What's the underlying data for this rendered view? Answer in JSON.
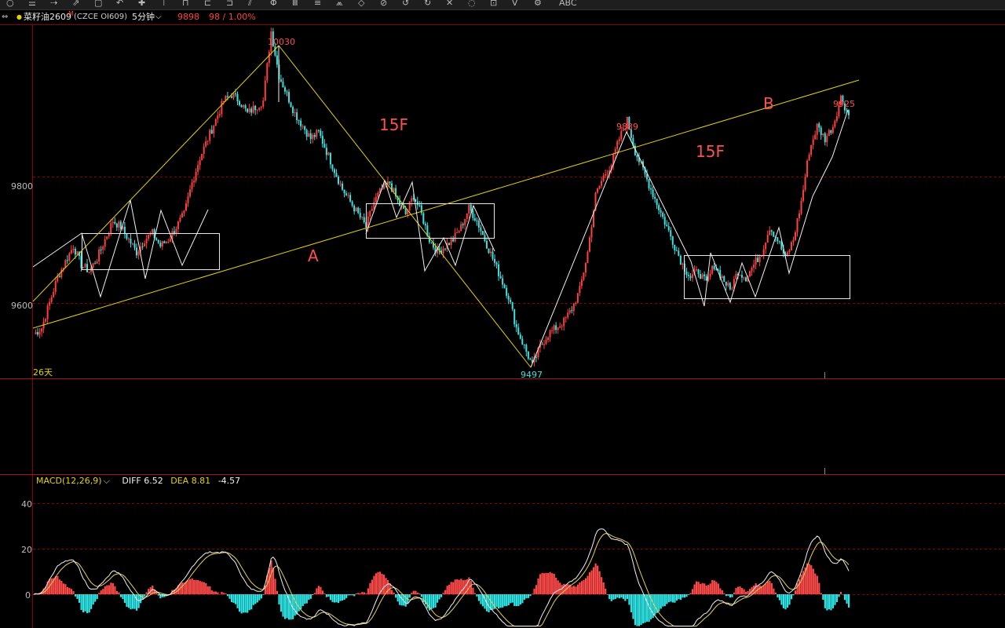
{
  "toolbar": {
    "icons": [
      "circle-icon",
      "list-icon",
      "arrow-icon",
      "pointer-icon",
      "draw-icon",
      "select-icon",
      "crosshair-icon",
      "measure-icon",
      "line-icon",
      "ray-icon",
      "channel-icon",
      "parallel-icon",
      "fib-icon",
      "text-icon",
      "grid-icon",
      "pattern-icon",
      "shape-icon",
      "cycle-icon",
      "undo-icon",
      "redo-icon",
      "delete-icon",
      "hide-icon",
      "lock-icon",
      "magnet-icon",
      "settings-icon"
    ],
    "abc_label": "ABC"
  },
  "header": {
    "prefix_icon": "⇔",
    "dot": "●",
    "name": "菜籽油2609",
    "marker": "M",
    "code": "(CZCE OI609)",
    "period": "5分钟",
    "period_caret": "⌵",
    "last_price": "9898",
    "change": "98 / 1.00%"
  },
  "colors": {
    "up": "#ff4040",
    "down": "#40e0e0",
    "trend_line": "#e6d200",
    "box": "#e8e8e8",
    "grid": "#8b0000",
    "macd_pos": "#ff4a4a",
    "macd_neg": "#2ee6e6",
    "diff_line": "#f0f0f0",
    "dea_line": "#e8d060",
    "annotation": "#ff5050",
    "label_yellow": "#e6d200"
  },
  "main_panel": {
    "y_ticks": [
      "9800",
      "9600"
    ],
    "days_label": "26天",
    "wave_labels": [
      "A",
      "15F",
      "15F",
      "B"
    ],
    "peak_labels": [
      "10030",
      "9497",
      "9889",
      "9925"
    ]
  },
  "macd": {
    "legend": {
      "name": "MACD(12,26,9)",
      "caret": "⌵",
      "diff": "DIFF 6.52",
      "dea": "DEA 8.81",
      "macd": "-4.57"
    },
    "y_ticks": [
      "40",
      "20",
      "0"
    ]
  },
  "chart_data": [
    {
      "type": "candlestick",
      "title": "菜籽油2609 (CZCE OI609) 5分钟",
      "ylim": [
        9480,
        10040
      ],
      "y_ticks": [
        9800,
        9600
      ],
      "close_path": [
        [
          0,
          9550
        ],
        [
          2,
          9560
        ],
        [
          4,
          9600
        ],
        [
          6,
          9640
        ],
        [
          8,
          9665
        ],
        [
          10,
          9690
        ],
        [
          12,
          9660
        ],
        [
          14,
          9650
        ],
        [
          16,
          9670
        ],
        [
          18,
          9700
        ],
        [
          20,
          9730
        ],
        [
          22,
          9720
        ],
        [
          24,
          9700
        ],
        [
          26,
          9680
        ],
        [
          28,
          9700
        ],
        [
          30,
          9710
        ],
        [
          32,
          9690
        ],
        [
          34,
          9700
        ],
        [
          36,
          9720
        ],
        [
          38,
          9740
        ],
        [
          40,
          9790
        ],
        [
          42,
          9830
        ],
        [
          44,
          9860
        ],
        [
          46,
          9890
        ],
        [
          48,
          9920
        ],
        [
          50,
          9930
        ],
        [
          52,
          9920
        ],
        [
          54,
          9900
        ],
        [
          56,
          9910
        ],
        [
          58,
          9920
        ],
        [
          60,
          10030
        ],
        [
          62,
          9960
        ],
        [
          64,
          9930
        ],
        [
          66,
          9900
        ],
        [
          68,
          9880
        ],
        [
          70,
          9860
        ],
        [
          72,
          9870
        ],
        [
          74,
          9840
        ],
        [
          76,
          9810
        ],
        [
          78,
          9780
        ],
        [
          80,
          9760
        ],
        [
          82,
          9740
        ],
        [
          84,
          9720
        ],
        [
          86,
          9760
        ],
        [
          88,
          9780
        ],
        [
          90,
          9790
        ],
        [
          92,
          9760
        ],
        [
          94,
          9740
        ],
        [
          96,
          9770
        ],
        [
          98,
          9740
        ],
        [
          100,
          9700
        ],
        [
          102,
          9680
        ],
        [
          104,
          9690
        ],
        [
          106,
          9700
        ],
        [
          108,
          9720
        ],
        [
          110,
          9750
        ],
        [
          112,
          9730
        ],
        [
          114,
          9700
        ],
        [
          116,
          9670
        ],
        [
          118,
          9640
        ],
        [
          120,
          9610
        ],
        [
          122,
          9560
        ],
        [
          124,
          9530
        ],
        [
          126,
          9500
        ],
        [
          128,
          9530
        ],
        [
          130,
          9550
        ],
        [
          132,
          9560
        ],
        [
          134,
          9570
        ],
        [
          136,
          9590
        ],
        [
          138,
          9620
        ],
        [
          140,
          9680
        ],
        [
          142,
          9770
        ],
        [
          144,
          9800
        ],
        [
          146,
          9820
        ],
        [
          148,
          9860
        ],
        [
          150,
          9889
        ],
        [
          152,
          9840
        ],
        [
          154,
          9810
        ],
        [
          156,
          9780
        ],
        [
          158,
          9750
        ],
        [
          160,
          9720
        ],
        [
          162,
          9690
        ],
        [
          164,
          9660
        ],
        [
          166,
          9640
        ],
        [
          168,
          9650
        ],
        [
          170,
          9630
        ],
        [
          172,
          9660
        ],
        [
          174,
          9640
        ],
        [
          176,
          9620
        ],
        [
          178,
          9650
        ],
        [
          180,
          9640
        ],
        [
          182,
          9660
        ],
        [
          184,
          9680
        ],
        [
          186,
          9720
        ],
        [
          188,
          9700
        ],
        [
          190,
          9670
        ],
        [
          192,
          9700
        ],
        [
          194,
          9760
        ],
        [
          196,
          9840
        ],
        [
          198,
          9880
        ],
        [
          200,
          9860
        ],
        [
          202,
          9880
        ],
        [
          204,
          9925
        ],
        [
          206,
          9898
        ]
      ],
      "peaks": [
        {
          "label": "10030",
          "value": 10030
        },
        {
          "label": "9497",
          "value": 9497
        },
        {
          "label": "9889",
          "value": 9889
        },
        {
          "label": "9925",
          "value": 9925
        }
      ],
      "annotations": [
        "A",
        "15F",
        "15F",
        "B"
      ]
    },
    {
      "type": "macd",
      "title": "MACD(12,26,9)",
      "ylim": [
        -8,
        46
      ],
      "y_ticks": [
        40,
        20,
        0
      ],
      "series": [
        {
          "name": "DIFF",
          "last": 6.52
        },
        {
          "name": "DEA",
          "last": 8.81
        },
        {
          "name": "MACD",
          "last": -4.57
        }
      ]
    }
  ]
}
